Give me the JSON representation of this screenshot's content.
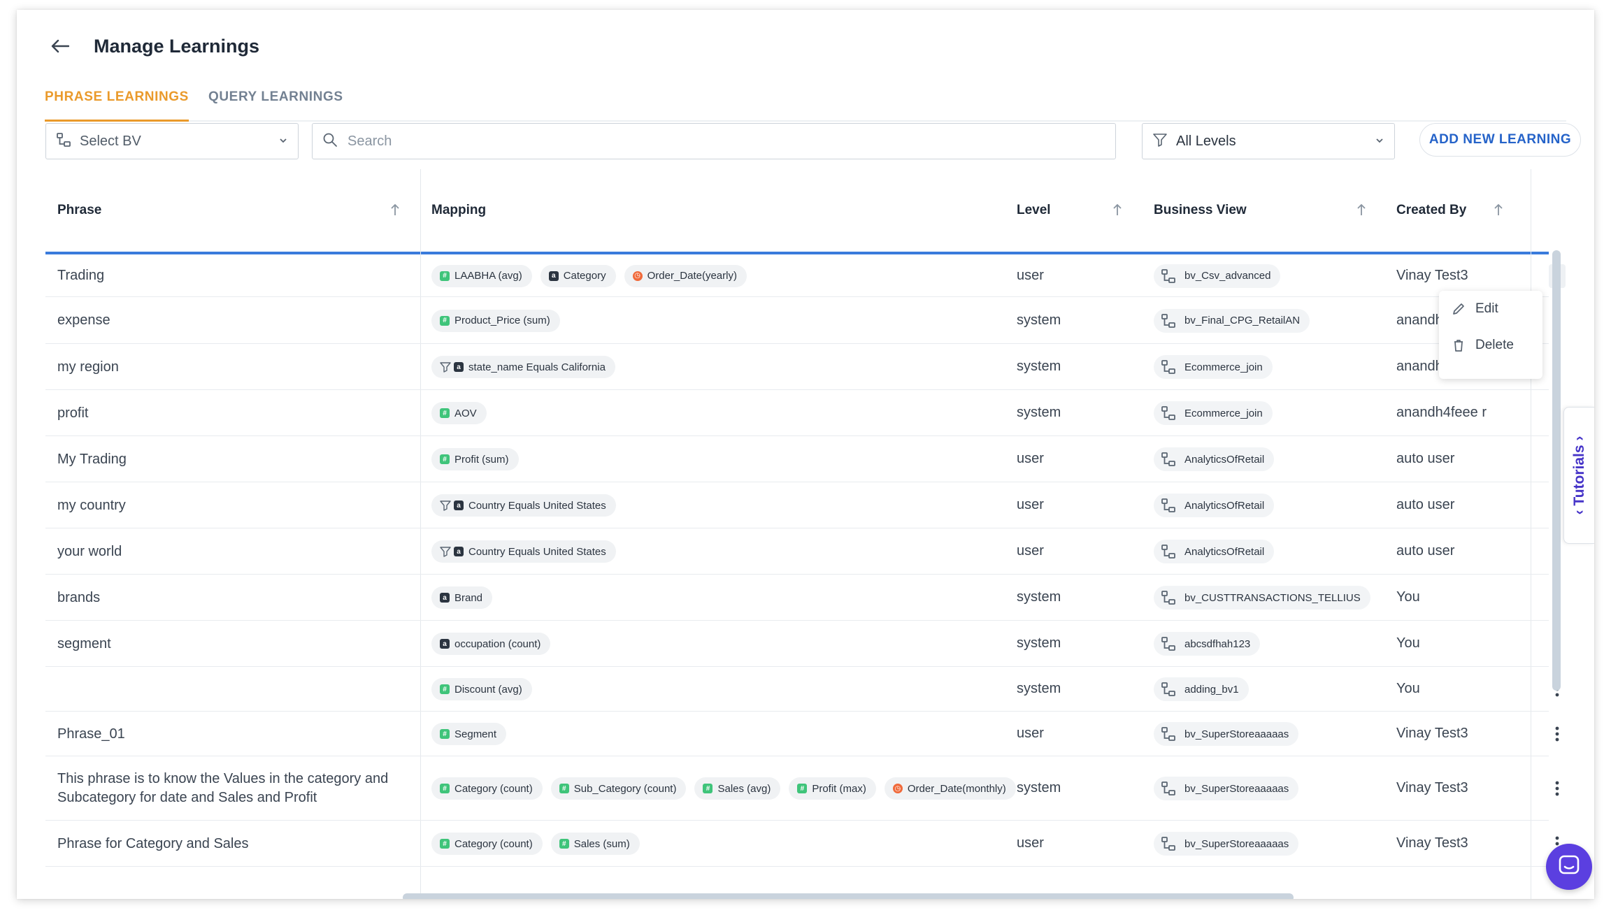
{
  "header": {
    "title": "Manage Learnings"
  },
  "tabs": [
    {
      "label": "PHRASE LEARNINGS",
      "active": true
    },
    {
      "label": "QUERY LEARNINGS",
      "active": false
    }
  ],
  "toolbar": {
    "select_bv": "Select BV",
    "search_placeholder": "Search",
    "levels": "All Levels",
    "add_button": "ADD NEW LEARNING"
  },
  "columns": {
    "phrase": "Phrase",
    "mapping": "Mapping",
    "level": "Level",
    "business_view": "Business View",
    "created_by": "Created By"
  },
  "rows": [
    {
      "phrase": [
        "Trading"
      ],
      "mapping": [
        {
          "type": "m",
          "text": "LAABHA (avg)"
        },
        {
          "type": "a",
          "text": "Category"
        },
        {
          "type": "d",
          "text": "Order_Date(yearly)"
        }
      ],
      "level": "user",
      "bv": "bv_Csv_advanced",
      "by": "Vinay Test3"
    },
    {
      "phrase": [
        "expense"
      ],
      "mapping": [
        {
          "type": "m",
          "text": "Product_Price (sum)"
        }
      ],
      "level": "system",
      "bv": "bv_Final_CPG_RetailAN",
      "by": "anandh"
    },
    {
      "phrase": [
        "my region"
      ],
      "mapping": [
        {
          "type": "fa",
          "text": "state_name Equals California"
        }
      ],
      "level": "system",
      "bv": "Ecommerce_join",
      "by": "anandh"
    },
    {
      "phrase": [
        "profit"
      ],
      "mapping": [
        {
          "type": "m",
          "text": "AOV"
        }
      ],
      "level": "system",
      "bv": "Ecommerce_join",
      "by": "anandh4feee r"
    },
    {
      "phrase": [
        "My Trading"
      ],
      "mapping": [
        {
          "type": "m",
          "text": "Profit (sum)"
        }
      ],
      "level": "user",
      "bv": "AnalyticsOfRetail",
      "by": "auto user"
    },
    {
      "phrase": [
        "my country"
      ],
      "mapping": [
        {
          "type": "fa",
          "text": "Country Equals United States"
        }
      ],
      "level": "user",
      "bv": "AnalyticsOfRetail",
      "by": "auto user"
    },
    {
      "phrase": [
        "your world"
      ],
      "mapping": [
        {
          "type": "fa",
          "text": "Country Equals United States"
        }
      ],
      "level": "user",
      "bv": "AnalyticsOfRetail",
      "by": "auto user"
    },
    {
      "phrase": [
        "brands"
      ],
      "mapping": [
        {
          "type": "a",
          "text": "Brand"
        }
      ],
      "level": "system",
      "bv": "bv_CUSTTRANSACTIONS_TELLIUS",
      "by": "You"
    },
    {
      "phrase": [
        "segment"
      ],
      "mapping": [
        {
          "type": "a",
          "text": "occupation (count)"
        }
      ],
      "level": "system",
      "bv": "abcsdfhah123",
      "by": "You"
    },
    {
      "phrase": [
        ""
      ],
      "mapping": [
        {
          "type": "m",
          "text": "Discount (avg)"
        }
      ],
      "level": "system",
      "bv": "adding_bv1",
      "by": "You"
    },
    {
      "phrase": [
        "Phrase_01"
      ],
      "mapping": [
        {
          "type": "m",
          "text": "Segment"
        }
      ],
      "level": "user",
      "bv": "bv_SuperStoreaaaaas",
      "by": "Vinay Test3"
    },
    {
      "phrase": [
        "This phrase is to know the Values in the category and",
        "Subcategory for date and Sales and Profit"
      ],
      "mapping": [
        {
          "type": "m",
          "text": "Category (count)"
        },
        {
          "type": "m",
          "text": "Sub_Category (count)"
        },
        {
          "type": "m",
          "text": "Sales (avg)"
        },
        {
          "type": "m",
          "text": "Profit (max)"
        },
        {
          "type": "d",
          "text": "Order_Date(monthly)"
        }
      ],
      "level": "system",
      "bv": "bv_SuperStoreaaaaas",
      "by": "Vinay Test3"
    },
    {
      "phrase": [
        "Phrase for Category and Sales"
      ],
      "mapping": [
        {
          "type": "m",
          "text": "Category (count)"
        },
        {
          "type": "m",
          "text": "Sales (sum)"
        }
      ],
      "level": "user",
      "bv": "bv_SuperStoreaaaaas",
      "by": "Vinay Test3"
    }
  ],
  "context_menu": {
    "edit": "Edit",
    "delete": "Delete"
  },
  "tutorials": "Tutorials",
  "colors": {
    "accent": "#ea9a2b",
    "primary": "#2563c9",
    "header_rule": "#3a7bdc",
    "chat": "#5b3fe0",
    "tutorials": "#4634c8"
  }
}
